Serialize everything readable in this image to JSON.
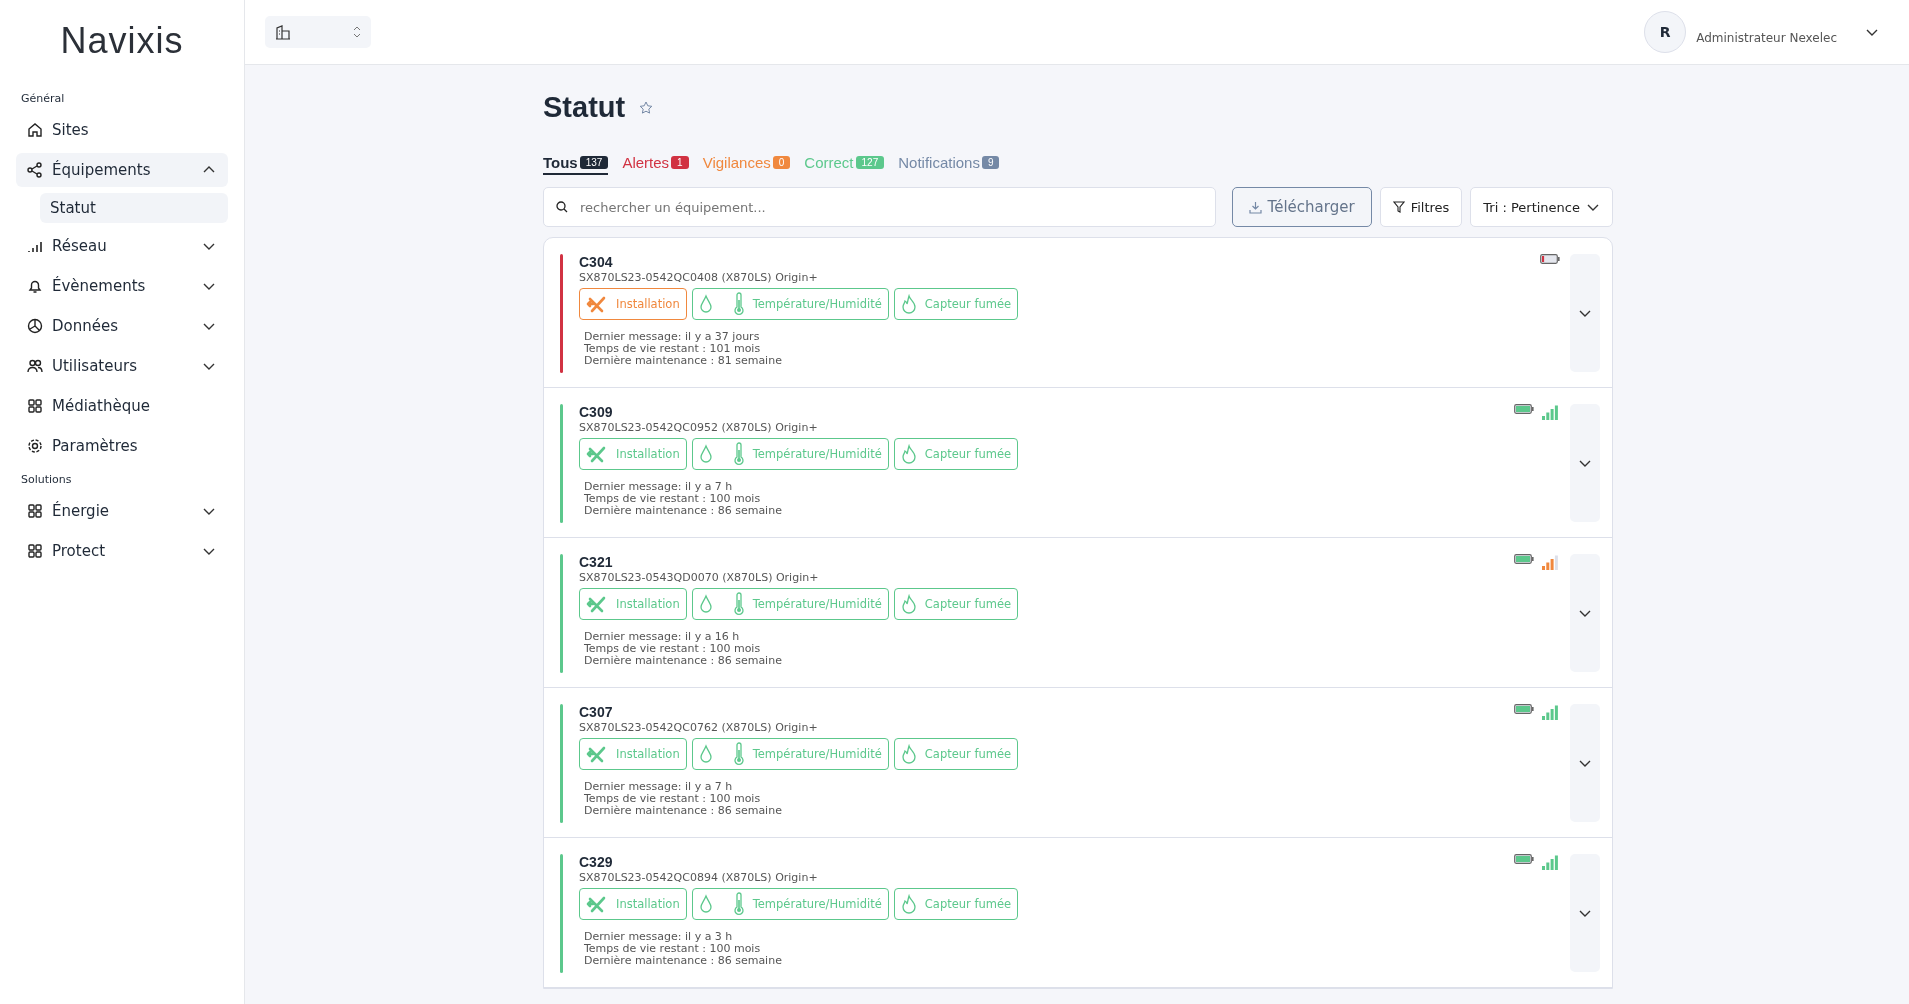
{
  "sidebar": {
    "logo": "Navixis",
    "sections": [
      {
        "title": "Général",
        "items": [
          {
            "label": "Sites",
            "selected": false
          },
          {
            "label": "Équipements",
            "expanded": true,
            "selected": true,
            "children": [
              {
                "label": "Statut",
                "selected": true
              }
            ]
          },
          {
            "label": "Réseau",
            "expanded": false,
            "selected": false
          },
          {
            "label": "Évènements",
            "expanded": false,
            "selected": false
          },
          {
            "label": "Données",
            "expanded": false,
            "selected": false
          },
          {
            "label": "Utilisateurs",
            "expanded": false,
            "selected": false
          },
          {
            "label": "Médiathèque",
            "selected": false
          },
          {
            "label": "Paramètres",
            "selected": false
          }
        ]
      },
      {
        "title": "Solutions",
        "items": [
          {
            "label": "Énergie",
            "expanded": false,
            "selected": false
          },
          {
            "label": "Protect",
            "expanded": false,
            "selected": false
          }
        ]
      }
    ]
  },
  "header": {
    "user_initial": "R",
    "user_name": "Administrateur Nexelec"
  },
  "page": {
    "title": "Statut",
    "favorite": false
  },
  "tabs": [
    {
      "label": "Tous",
      "count": "137",
      "color": "#1f2937",
      "selected": true
    },
    {
      "label": "Alertes",
      "count": "1",
      "color": "#d13242",
      "selected": false
    },
    {
      "label": "Vigilances",
      "count": "0",
      "color": "#f0883e",
      "selected": false
    },
    {
      "label": "Correct",
      "count": "127",
      "color": "#5cc88c",
      "selected": false
    },
    {
      "label": "Notifications",
      "count": "9",
      "color": "#7589a6",
      "selected": false
    }
  ],
  "search": {
    "placeholder": "rechercher un équipement..."
  },
  "buttons": {
    "download": "Télécharger",
    "filters": "Filtres",
    "sort": "Tri : Pertinence"
  },
  "devices": [
    {
      "name": "C304",
      "serial": "SX870LS23-0542QC0408 (X870LS) Origin+",
      "color": "#d13242",
      "battery": {
        "kind": "low"
      },
      "chips": [
        {
          "kind": "install",
          "label": "Installation",
          "color": "#f0883e"
        },
        {
          "kind": "temphum",
          "label": "Température/Humidité",
          "color": "#5cc88c"
        },
        {
          "kind": "smoke",
          "label": "Capteur fumée",
          "color": "#5cc88c"
        }
      ],
      "details": [
        "Dernier message: il y a 37 jours",
        "Temps de vie restant : 101 mois",
        "Dernière maintenance : 81 semaine"
      ]
    },
    {
      "name": "C309",
      "serial": "SX870LS23-0542QC0952 (X870LS) Origin+",
      "color": "#5cc88c",
      "battery": {
        "kind": "full"
      },
      "signal": {
        "kind": "strong"
      },
      "chips": [
        {
          "kind": "install",
          "label": "Installation",
          "color": "#5cc88c"
        },
        {
          "kind": "temphum",
          "label": "Température/Humidité",
          "color": "#5cc88c"
        },
        {
          "kind": "smoke",
          "label": "Capteur fumée",
          "color": "#5cc88c"
        }
      ],
      "details": [
        "Dernier message: il y a 7 h",
        "Temps de vie restant : 100 mois",
        "Dernière maintenance : 86 semaine"
      ]
    },
    {
      "name": "C321",
      "serial": "SX870LS23-0543QD0070 (X870LS) Origin+",
      "color": "#5cc88c",
      "battery": {
        "kind": "full"
      },
      "signal": {
        "kind": "medium"
      },
      "chips": [
        {
          "kind": "install",
          "label": "Installation",
          "color": "#5cc88c"
        },
        {
          "kind": "temphum",
          "label": "Température/Humidité",
          "color": "#5cc88c"
        },
        {
          "kind": "smoke",
          "label": "Capteur fumée",
          "color": "#5cc88c"
        }
      ],
      "details": [
        "Dernier message: il y a 16 h",
        "Temps de vie restant : 100 mois",
        "Dernière maintenance : 86 semaine"
      ]
    },
    {
      "name": "C307",
      "serial": "SX870LS23-0542QC0762 (X870LS) Origin+",
      "color": "#5cc88c",
      "battery": {
        "kind": "full"
      },
      "signal": {
        "kind": "strong"
      },
      "chips": [
        {
          "kind": "install",
          "label": "Installation",
          "color": "#5cc88c"
        },
        {
          "kind": "temphum",
          "label": "Température/Humidité",
          "color": "#5cc88c"
        },
        {
          "kind": "smoke",
          "label": "Capteur fumée",
          "color": "#5cc88c"
        }
      ],
      "details": [
        "Dernier message: il y a 7 h",
        "Temps de vie restant : 100 mois",
        "Dernière maintenance : 86 semaine"
      ]
    },
    {
      "name": "C329",
      "serial": "SX870LS23-0542QC0894 (X870LS) Origin+",
      "color": "#5cc88c",
      "battery": {
        "kind": "full"
      },
      "signal": {
        "kind": "strong"
      },
      "chips": [
        {
          "kind": "install",
          "label": "Installation",
          "color": "#5cc88c"
        },
        {
          "kind": "temphum",
          "label": "Température/Humidité",
          "color": "#5cc88c"
        },
        {
          "kind": "smoke",
          "label": "Capteur fumée",
          "color": "#5cc88c"
        }
      ],
      "details": [
        "Dernier message: il y a 3 h",
        "Temps de vie restant : 100 mois",
        "Dernière maintenance : 86 semaine"
      ]
    }
  ]
}
